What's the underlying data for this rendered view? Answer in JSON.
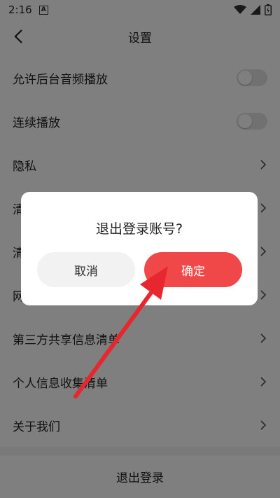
{
  "status_bar": {
    "time": "2:16",
    "notification_letter": "A"
  },
  "header": {
    "title": "设置"
  },
  "settings": {
    "items": [
      {
        "label": "允许后台音频播放",
        "control": "toggle",
        "on": false
      },
      {
        "label": "连续播放",
        "control": "toggle",
        "on": false
      },
      {
        "label": "隐私",
        "control": "chevron"
      },
      {
        "label": "清",
        "control": "chevron"
      },
      {
        "label": "清",
        "control": "chevron"
      },
      {
        "label": "网",
        "control": "chevron"
      },
      {
        "label": "第三方共享信息清单",
        "control": "chevron"
      },
      {
        "label": "个人信息收集清单",
        "control": "chevron"
      },
      {
        "label": "关于我们",
        "control": "chevron"
      }
    ]
  },
  "logout": {
    "label": "退出登录"
  },
  "dialog": {
    "title": "退出登录账号?",
    "cancel_label": "取消",
    "confirm_label": "确定"
  },
  "colors": {
    "accent": "#f04848",
    "annotation_arrow": "#e8262d"
  }
}
